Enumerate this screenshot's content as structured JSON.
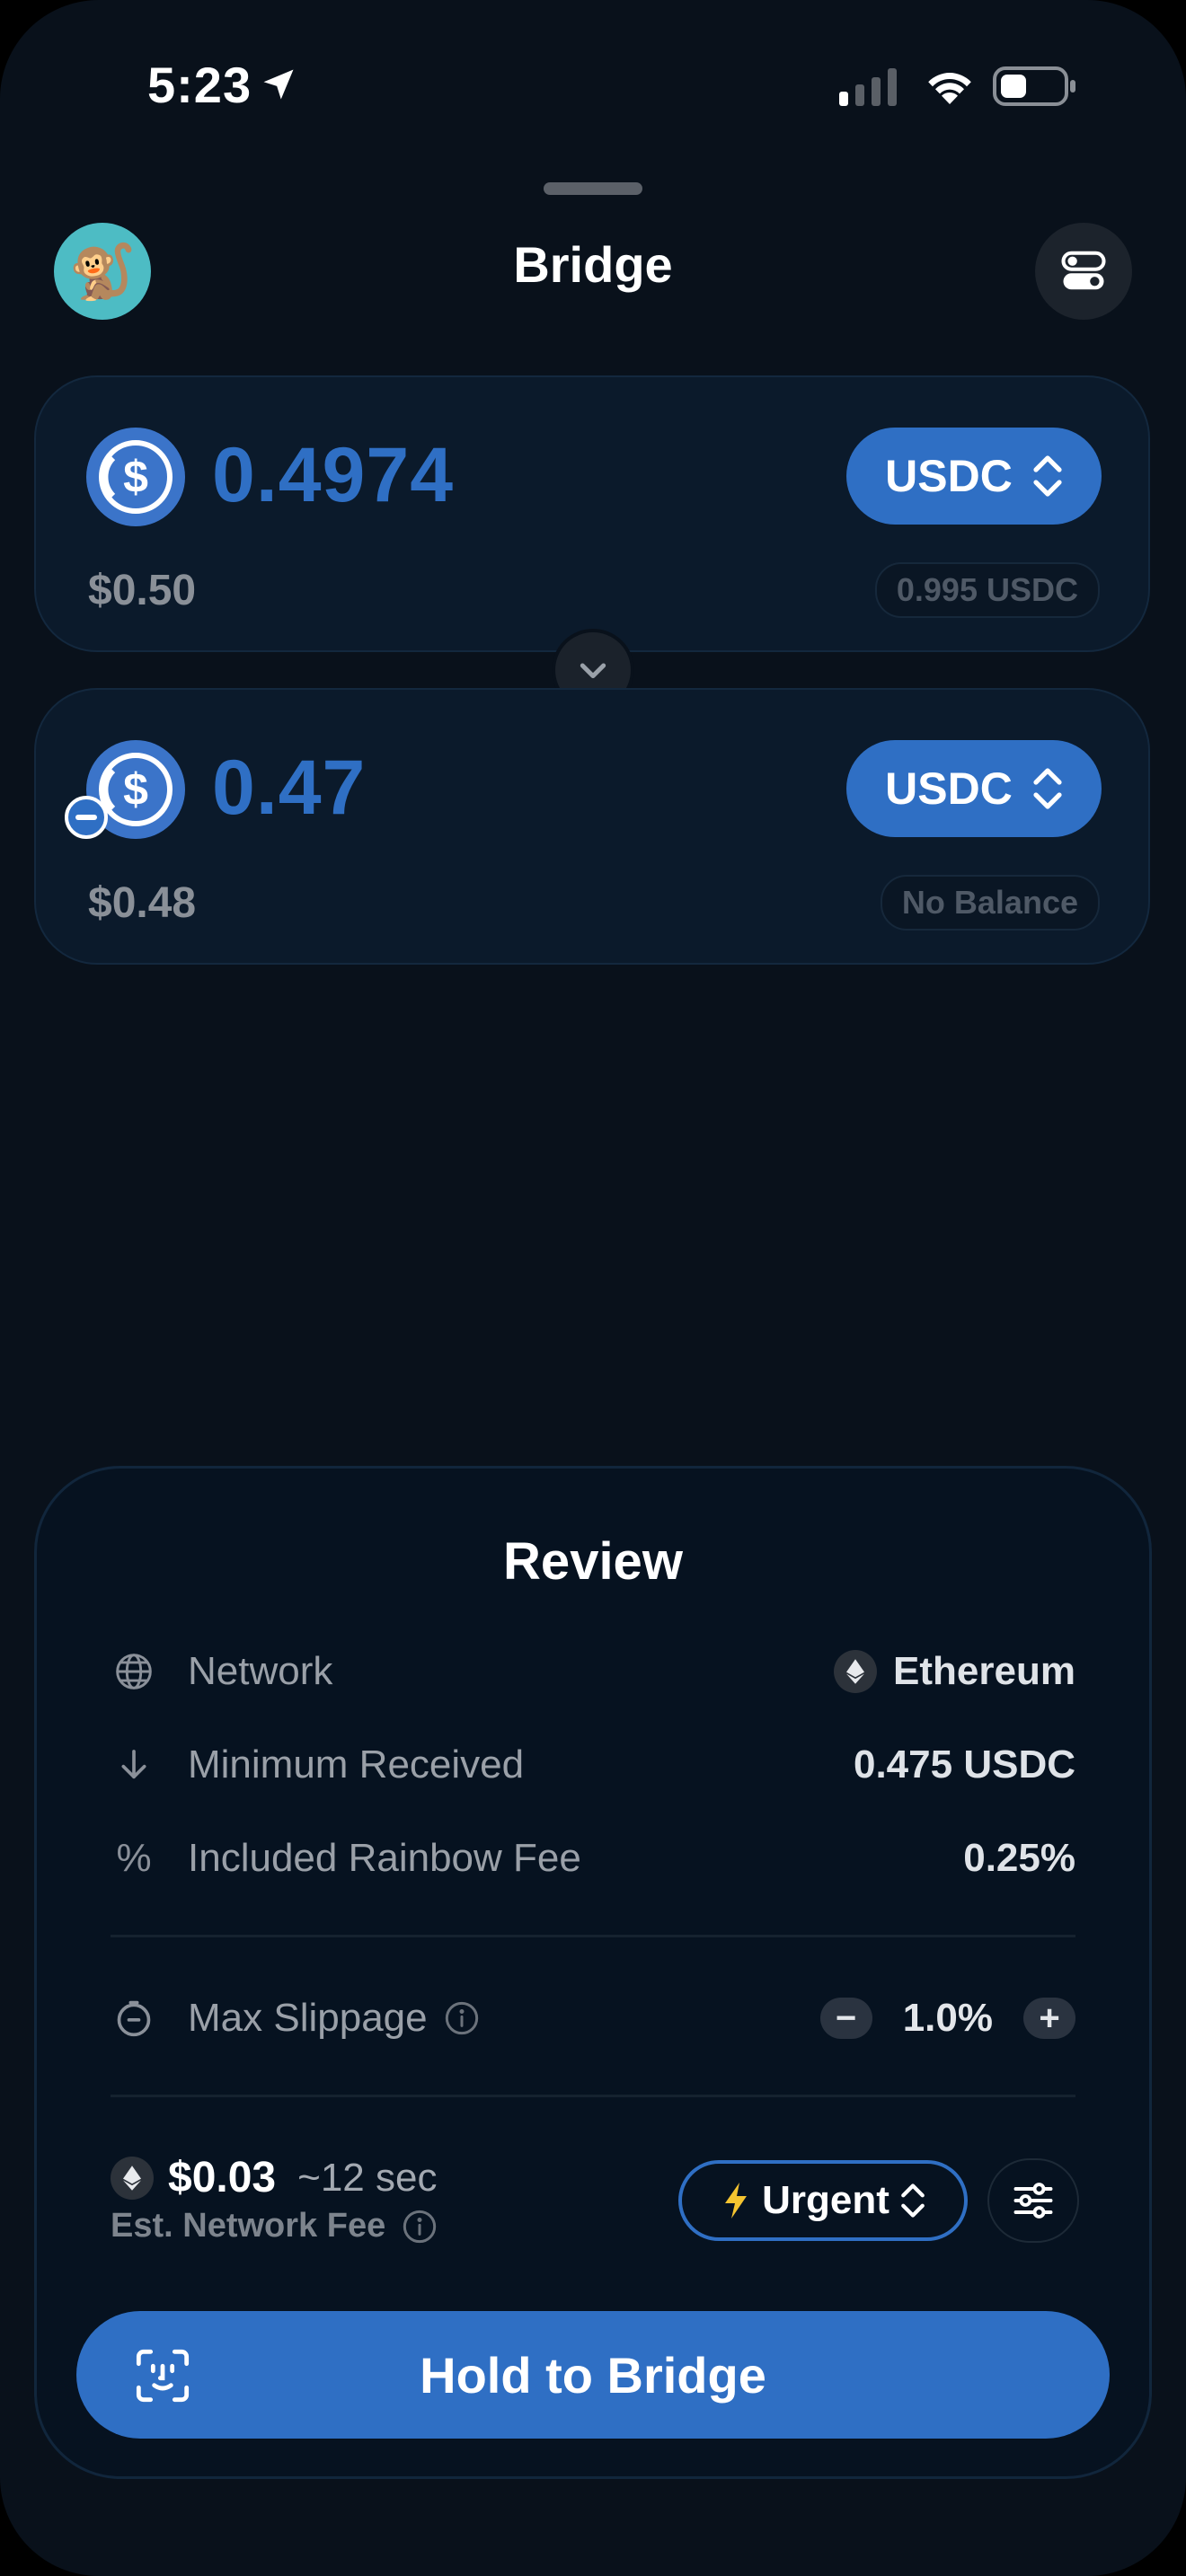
{
  "status_bar": {
    "time": "5:23",
    "icons": [
      "location-arrow-icon",
      "cellular-signal-icon",
      "wifi-icon",
      "battery-icon"
    ]
  },
  "header": {
    "title": "Bridge",
    "avatar_emoji": "🐒",
    "settings_icon": "toggle-settings-icon"
  },
  "input_card": {
    "amount": "0.4974",
    "fiat_value": "$0.50",
    "token_symbol": "USDC",
    "balance": "0.995 USDC"
  },
  "output_card": {
    "amount": "0.47",
    "fiat_value": "$0.48",
    "token_symbol": "USDC",
    "balance": "No Balance"
  },
  "review": {
    "title": "Review",
    "rows": [
      {
        "icon": "globe-icon",
        "label": "Network",
        "value": "Ethereum"
      },
      {
        "icon": "arrow-down-icon",
        "label": "Minimum Received",
        "value": "0.475 USDC"
      },
      {
        "icon": "percent-icon",
        "label": "Included Rainbow Fee",
        "value": "0.25%"
      }
    ],
    "slippage": {
      "label": "Max Slippage",
      "value": "1.0%",
      "decrement": "−",
      "increment": "+"
    },
    "network_fee": {
      "amount": "$0.03",
      "time": "~12 sec",
      "label": "Est. Network Fee"
    },
    "gas_speed": "Urgent",
    "action_label": "Hold to Bridge"
  },
  "colors": {
    "accent": "#2f6fc4",
    "background": "#09111b",
    "card": "#0b1a2b",
    "avatar_bg": "#4dbcc4"
  }
}
